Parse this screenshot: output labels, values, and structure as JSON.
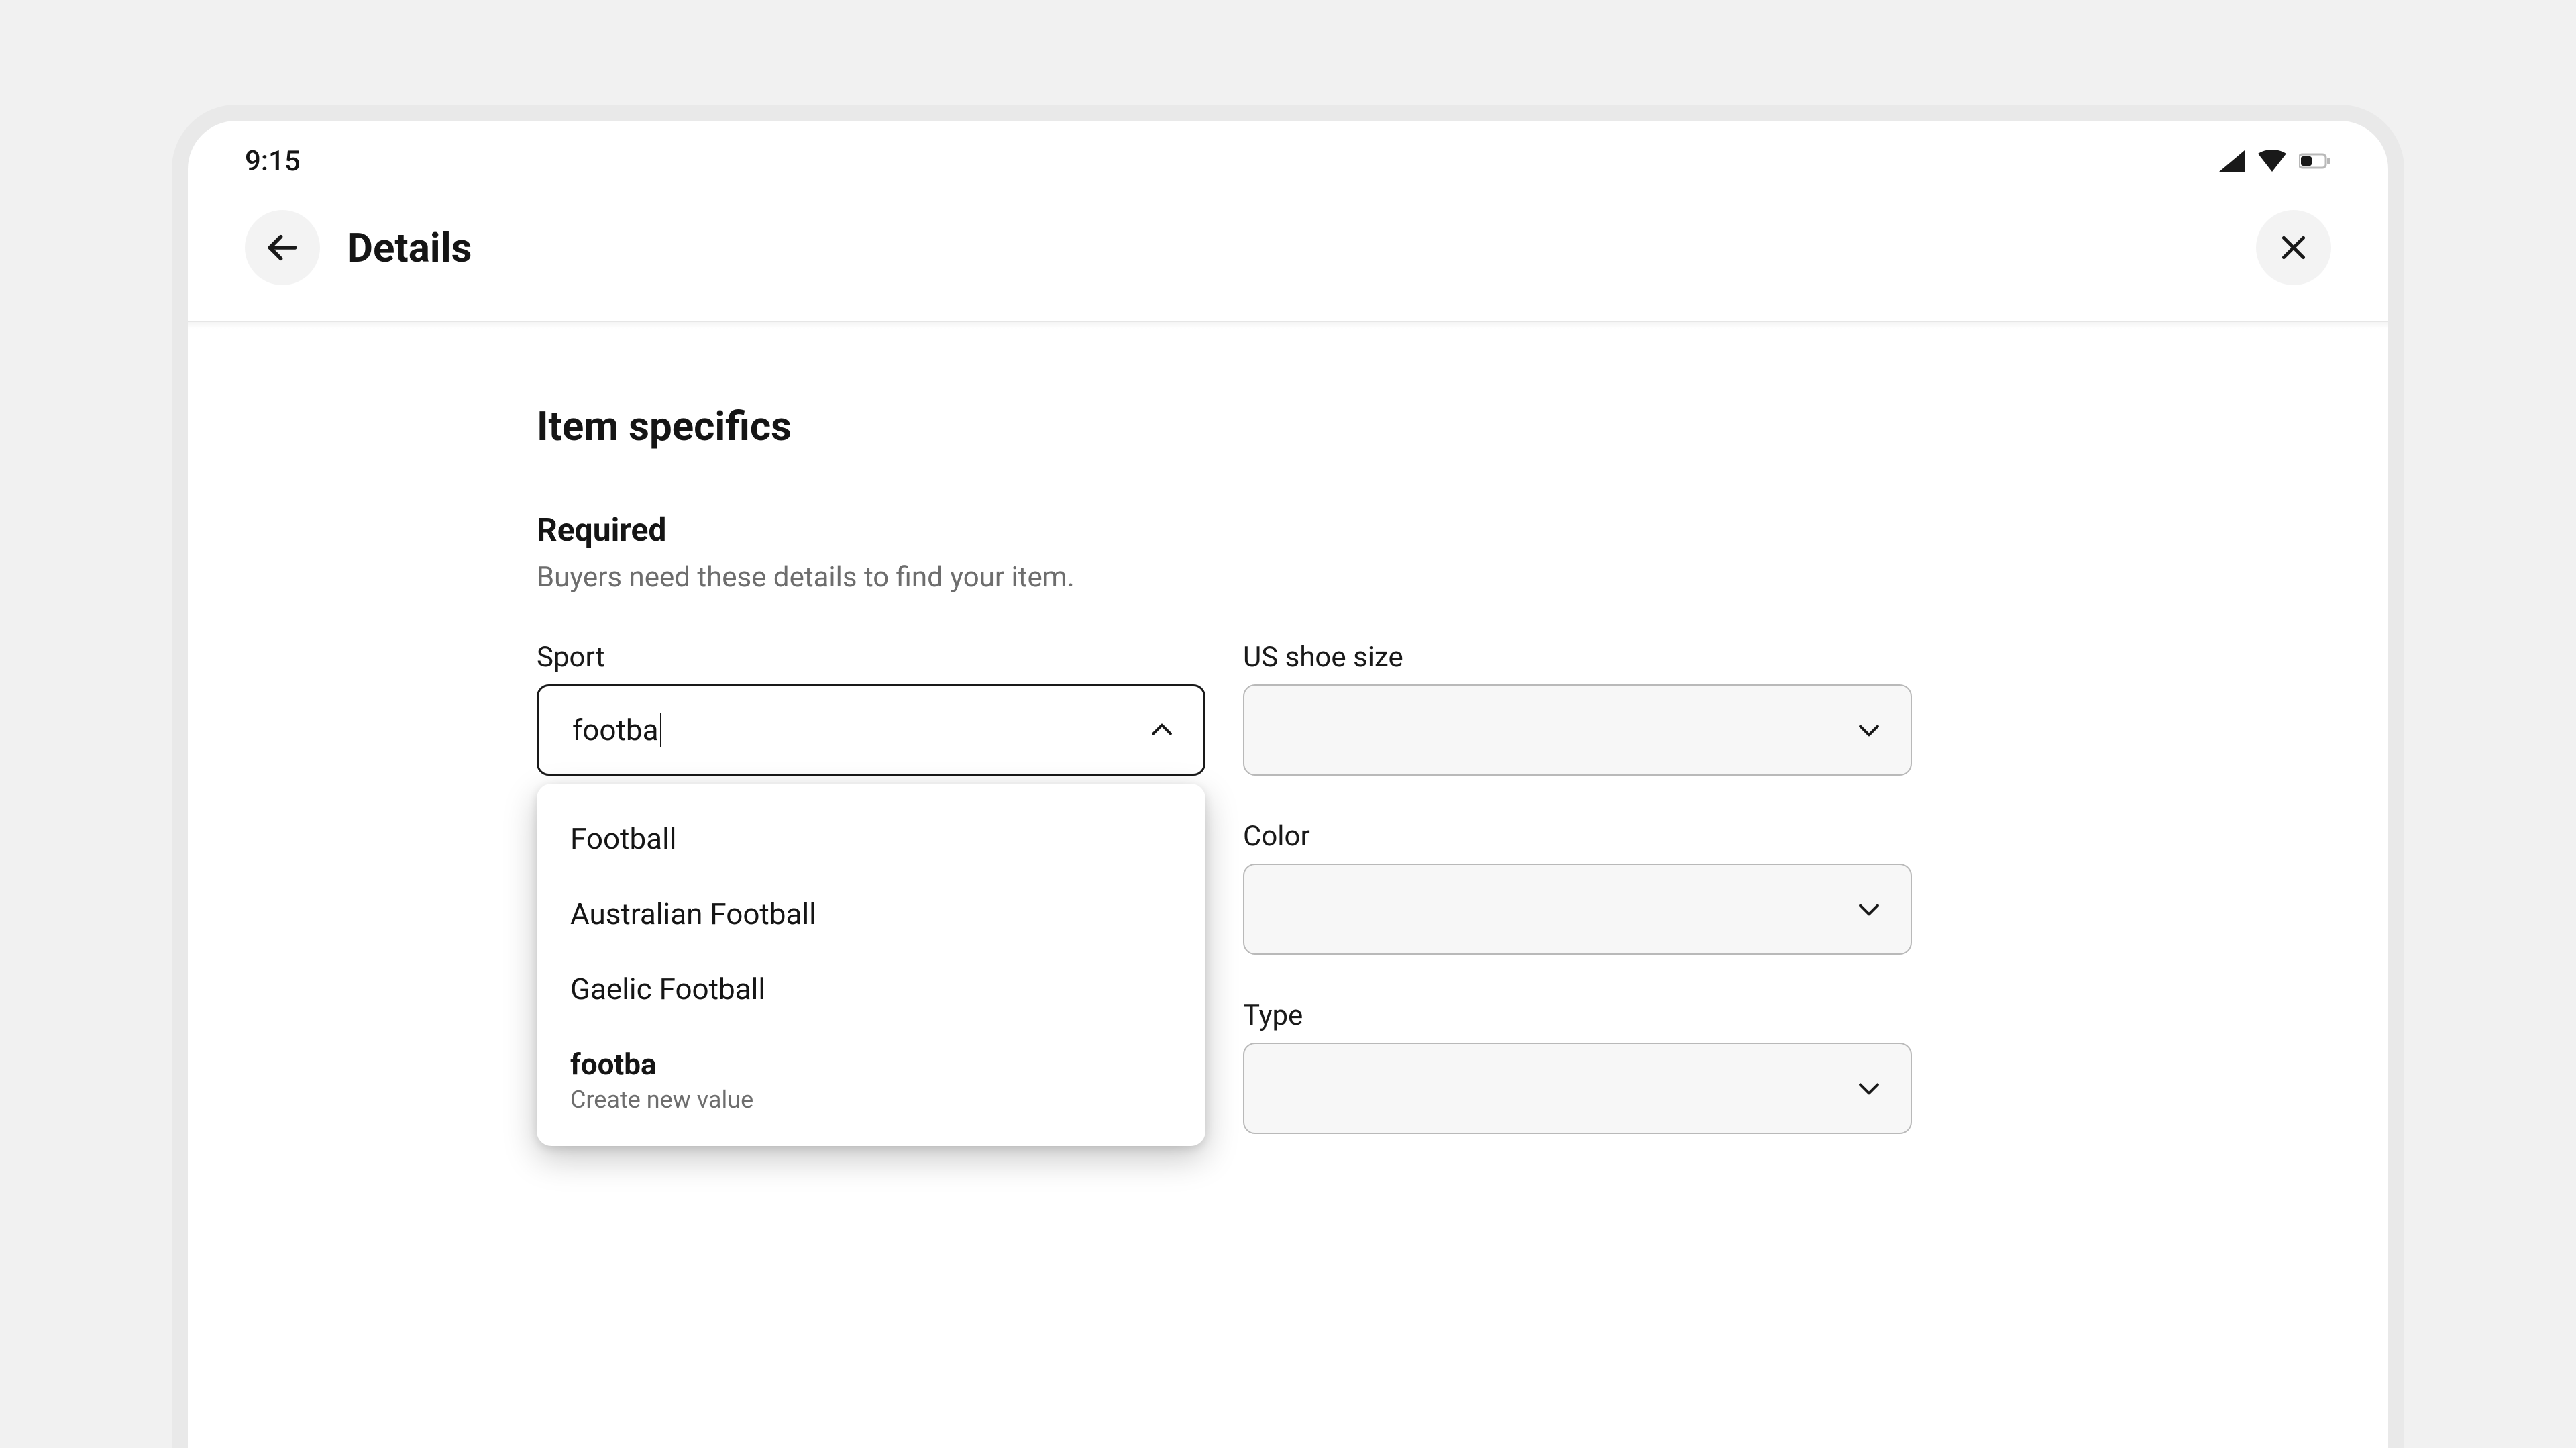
{
  "statusbar": {
    "time": "9:15"
  },
  "header": {
    "title": "Details"
  },
  "section": {
    "title": "Item specifics",
    "required_label": "Required",
    "required_hint": "Buyers need these details to find your item."
  },
  "fields": {
    "sport": {
      "label": "Sport",
      "input": "footba",
      "options": [
        "Football",
        "Australian Football",
        "Gaelic Football"
      ],
      "create_label": "footba",
      "create_sub": "Create new value"
    },
    "us_shoe_size": {
      "label": "US shoe size",
      "value": ""
    },
    "color": {
      "label": "Color",
      "value": ""
    },
    "type": {
      "label": "Type",
      "value": ""
    }
  }
}
